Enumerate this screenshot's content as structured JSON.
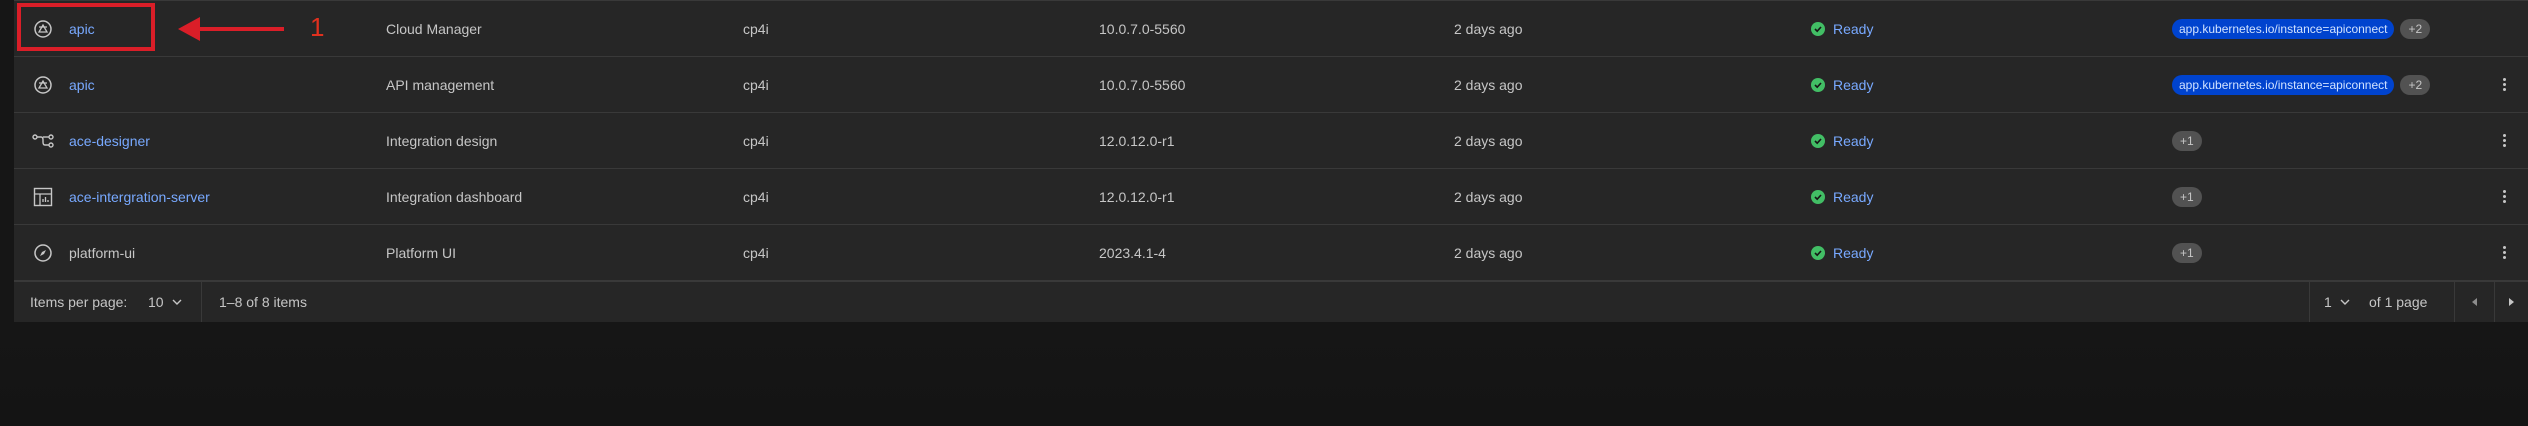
{
  "rows": [
    {
      "name": "apic",
      "name_link": true,
      "icon": "api-connect-icon",
      "description": "Cloud Manager",
      "namespace": "cp4i",
      "version": "10.0.7.0-5560",
      "age": "2 days ago",
      "status": "Ready",
      "label_tag": "app.kubernetes.io/instance=apiconnect",
      "more_tag": "+2",
      "has_menu": false
    },
    {
      "name": "apic",
      "name_link": true,
      "icon": "api-connect-icon",
      "description": "API management",
      "namespace": "cp4i",
      "version": "10.0.7.0-5560",
      "age": "2 days ago",
      "status": "Ready",
      "label_tag": "app.kubernetes.io/instance=apiconnect",
      "more_tag": "+2",
      "has_menu": true
    },
    {
      "name": "ace-designer",
      "name_link": true,
      "icon": "flow-icon",
      "description": "Integration design",
      "namespace": "cp4i",
      "version": "12.0.12.0-r1",
      "age": "2 days ago",
      "status": "Ready",
      "label_tag": "",
      "more_tag": "+1",
      "has_menu": true
    },
    {
      "name": "ace-intergration-server",
      "name_link": true,
      "icon": "dashboard-icon",
      "description": "Integration dashboard",
      "namespace": "cp4i",
      "version": "12.0.12.0-r1",
      "age": "2 days ago",
      "status": "Ready",
      "label_tag": "",
      "more_tag": "+1",
      "has_menu": true
    },
    {
      "name": "platform-ui",
      "name_link": false,
      "icon": "compass-icon",
      "description": "Platform UI",
      "namespace": "cp4i",
      "version": "2023.4.1-4",
      "age": "2 days ago",
      "status": "Ready",
      "label_tag": "",
      "more_tag": "+1",
      "has_menu": true
    }
  ],
  "pagination": {
    "items_per_page_label": "Items per page:",
    "items_per_page_value": "10",
    "range_text": "1–8 of 8 items",
    "page_value": "1",
    "page_total_text": "of 1 page"
  },
  "annotation": {
    "number": "1",
    "color": "#da1e28"
  },
  "colors": {
    "link": "#78a9ff",
    "status_ok": "#42be65",
    "tag_blue": "#0043ce",
    "tag_gray": "#525252"
  }
}
